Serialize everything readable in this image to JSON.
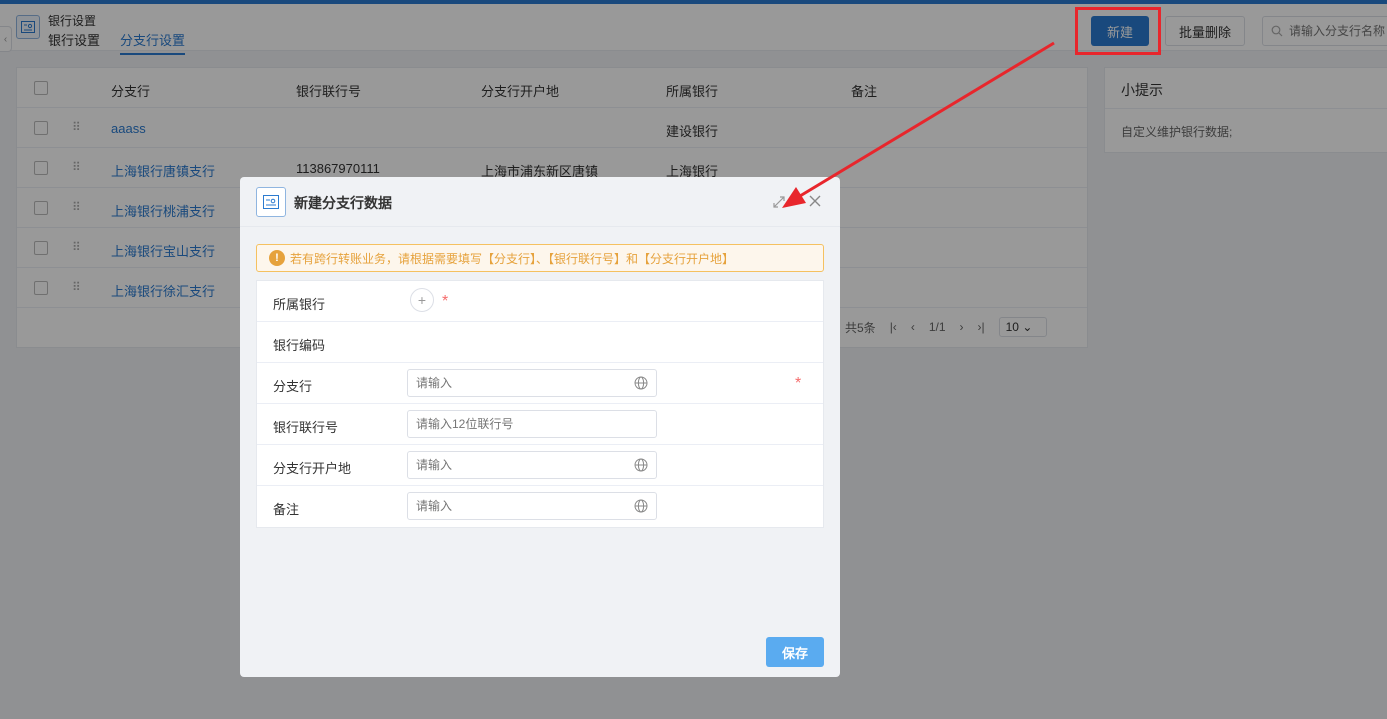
{
  "header": {
    "app_title": "银行设置",
    "tabs": [
      {
        "label": "银行设置"
      },
      {
        "label": "分支行设置"
      }
    ],
    "new_button": "新建",
    "batch_delete_button": "批量删除",
    "search_placeholder": "请输入分支行名称"
  },
  "table": {
    "columns": [
      "分支行",
      "银行联行号",
      "分支行开户地",
      "所属银行",
      "备注"
    ],
    "rows": [
      {
        "branch": "aaass",
        "code": "",
        "location": "",
        "bank": "建设银行",
        "note": ""
      },
      {
        "branch": "上海银行唐镇支行",
        "code": "113867970111",
        "location": "上海市浦东新区唐镇",
        "bank": "上海银行",
        "note": ""
      },
      {
        "branch": "上海银行桃浦支行",
        "code": "",
        "location": "",
        "bank": "",
        "note": ""
      },
      {
        "branch": "上海银行宝山支行",
        "code": "",
        "location": "",
        "bank": "",
        "note": ""
      },
      {
        "branch": "上海银行徐汇支行",
        "code": "",
        "location": "",
        "bank": "",
        "note": ""
      }
    ],
    "pager": {
      "total": "共5条",
      "page": "1/1",
      "page_size": "10"
    }
  },
  "tips": {
    "title": "小提示",
    "text": "自定义维护银行数据;"
  },
  "dialog": {
    "title": "新建分支行数据",
    "alert": "若有跨行转账业务，请根据需要填写【分支行】、【银行联行号】和【分支行开户地】",
    "fields": {
      "bank": {
        "label": "所属银行"
      },
      "bank_code": {
        "label": "银行编码"
      },
      "branch": {
        "label": "分支行",
        "placeholder": "请输入"
      },
      "union_code": {
        "label": "银行联行号",
        "placeholder": "请输入12位联行号"
      },
      "location": {
        "label": "分支行开户地",
        "placeholder": "请输入"
      },
      "note": {
        "label": "备注",
        "placeholder": "请输入"
      }
    },
    "save_button": "保存",
    "required_mark": "*"
  },
  "colors": {
    "primary": "#2b7bd0",
    "annotation_red": "#e8262c",
    "warning": "#e6a23c",
    "required": "#f56c6c"
  }
}
